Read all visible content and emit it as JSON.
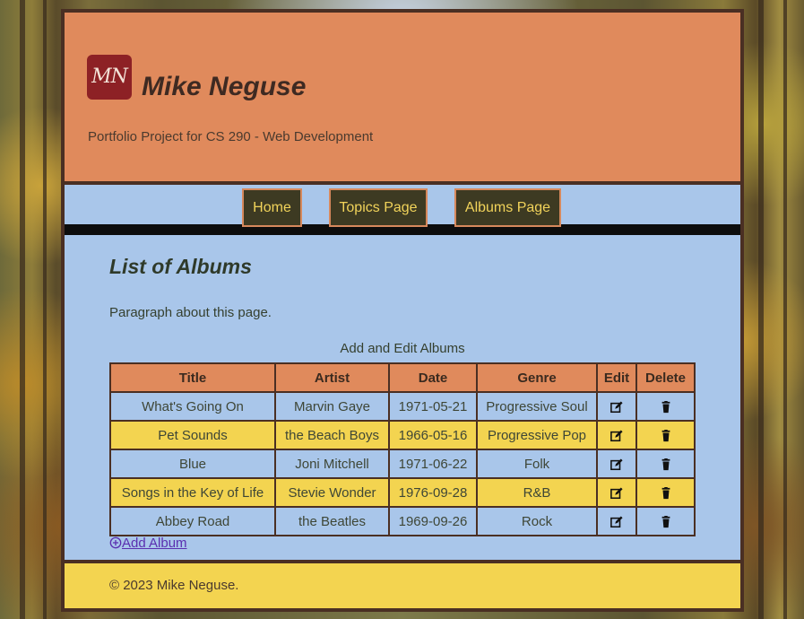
{
  "header": {
    "logo_text": "MN",
    "site_title": "Mike Neguse",
    "tagline": "Portfolio Project for CS 290 - Web Development"
  },
  "nav": {
    "items": [
      {
        "label": "Home"
      },
      {
        "label": "Topics Page"
      },
      {
        "label": "Albums Page"
      }
    ]
  },
  "main": {
    "title": "List of Albums",
    "paragraph": "Paragraph about this page.",
    "table_caption": "Add and Edit Albums",
    "columns": [
      "Title",
      "Artist",
      "Date",
      "Genre",
      "Edit",
      "Delete"
    ],
    "rows": [
      {
        "title": "What's Going On",
        "artist": "Marvin Gaye",
        "date": "1971-05-21",
        "genre": "Progressive Soul"
      },
      {
        "title": "Pet Sounds",
        "artist": "the Beach Boys",
        "date": "1966-05-16",
        "genre": "Progressive Pop"
      },
      {
        "title": "Blue",
        "artist": "Joni Mitchell",
        "date": "1971-06-22",
        "genre": "Folk"
      },
      {
        "title": "Songs in the Key of Life",
        "artist": "Stevie Wonder",
        "date": "1976-09-28",
        "genre": "R&B"
      },
      {
        "title": "Abbey Road",
        "artist": "the Beatles",
        "date": "1969-09-26",
        "genre": "Rock"
      }
    ],
    "add_link": "Add Album"
  },
  "footer": {
    "copyright": "© 2023 Mike Neguse."
  },
  "icons": {
    "edit": "edit-icon",
    "delete": "trash-icon",
    "add": "plus-circle-icon"
  },
  "colors": {
    "header_bg": "#e08a5c",
    "main_bg": "#a9c6ea",
    "accent_yellow": "#f3d450",
    "nav_button_bg": "#3d3a22",
    "border": "#4a2f23"
  }
}
